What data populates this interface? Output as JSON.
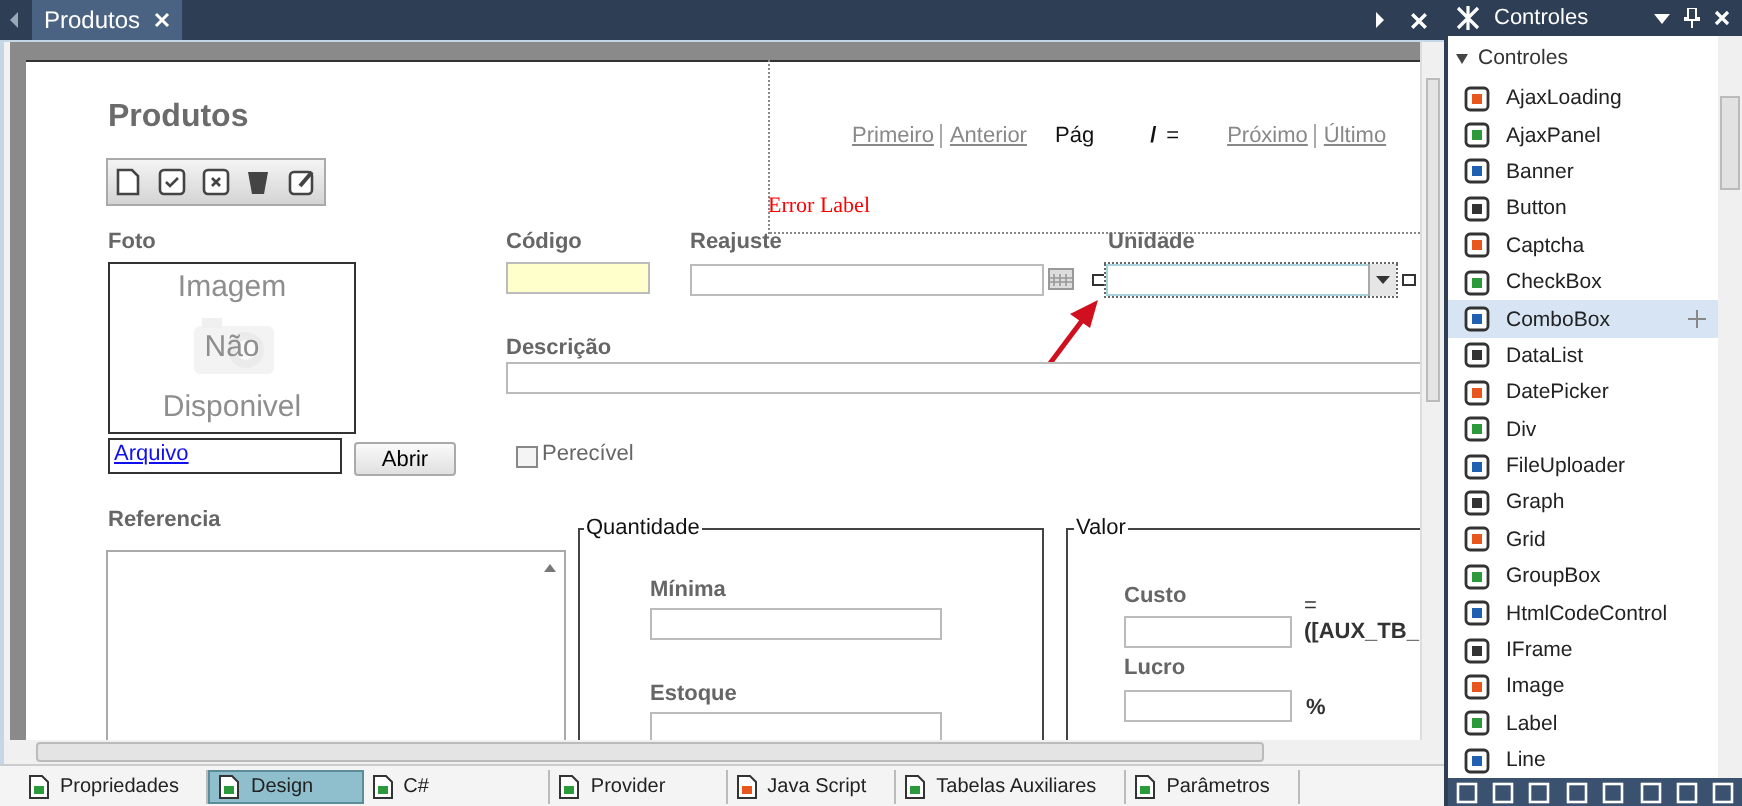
{
  "document_tabs": [
    {
      "label": "Produtos",
      "selected": true
    }
  ],
  "form": {
    "title": "Produtos",
    "pager": {
      "first": "Primeiro",
      "previous": "Anterior",
      "page": "Pág",
      "slash": "/",
      "equals": "=",
      "next": "Próximo",
      "last": "Último"
    },
    "error_label": "Error Label",
    "photo": {
      "label": "Foto",
      "placeholder_lines": [
        "Imagem",
        "Não",
        "Disponivel"
      ],
      "file_link": "Arquivo",
      "open_button": "Abrir"
    },
    "codigo": {
      "label": "Código"
    },
    "reajuste": {
      "label": "Reajuste"
    },
    "unidade": {
      "label": "Unidade"
    },
    "descricao": {
      "label": "Descrição"
    },
    "perecivel": {
      "label": "Perecível",
      "checked": false
    },
    "referencia": {
      "label": "Referencia"
    },
    "quantidade": {
      "legend": "Quantidade",
      "minima": "Mínima",
      "estoque": "Estoque"
    },
    "valor": {
      "legend": "Valor",
      "custo": "Custo",
      "formula_1": "=",
      "formula_2": "([AUX_TB_",
      "lucro": "Lucro",
      "percent": "%"
    }
  },
  "bottom_tabs": [
    {
      "label": "Propriedades",
      "selected": false
    },
    {
      "label": "Design",
      "selected": true
    },
    {
      "label": "C#",
      "selected": false
    },
    {
      "label": "Provider",
      "selected": false
    },
    {
      "label": "Java Script",
      "selected": false
    },
    {
      "label": "Tabelas Auxiliares",
      "selected": false
    },
    {
      "label": "Parâmetros",
      "selected": false
    }
  ],
  "controls_panel": {
    "title": "Controles",
    "group": "Controles",
    "items": [
      {
        "label": "AjaxLoading",
        "selected": false
      },
      {
        "label": "AjaxPanel",
        "selected": false
      },
      {
        "label": "Banner",
        "selected": false
      },
      {
        "label": "Button",
        "selected": false
      },
      {
        "label": "Captcha",
        "selected": false
      },
      {
        "label": "CheckBox",
        "selected": false
      },
      {
        "label": "ComboBox",
        "selected": true
      },
      {
        "label": "DataList",
        "selected": false
      },
      {
        "label": "DatePicker",
        "selected": false
      },
      {
        "label": "Div",
        "selected": false
      },
      {
        "label": "FileUploader",
        "selected": false
      },
      {
        "label": "Graph",
        "selected": false
      },
      {
        "label": "Grid",
        "selected": false
      },
      {
        "label": "GroupBox",
        "selected": false
      },
      {
        "label": "HtmlCodeControl",
        "selected": false
      },
      {
        "label": "IFrame",
        "selected": false
      },
      {
        "label": "Image",
        "selected": false
      },
      {
        "label": "Label",
        "selected": false
      },
      {
        "label": "Line",
        "selected": false
      }
    ]
  }
}
